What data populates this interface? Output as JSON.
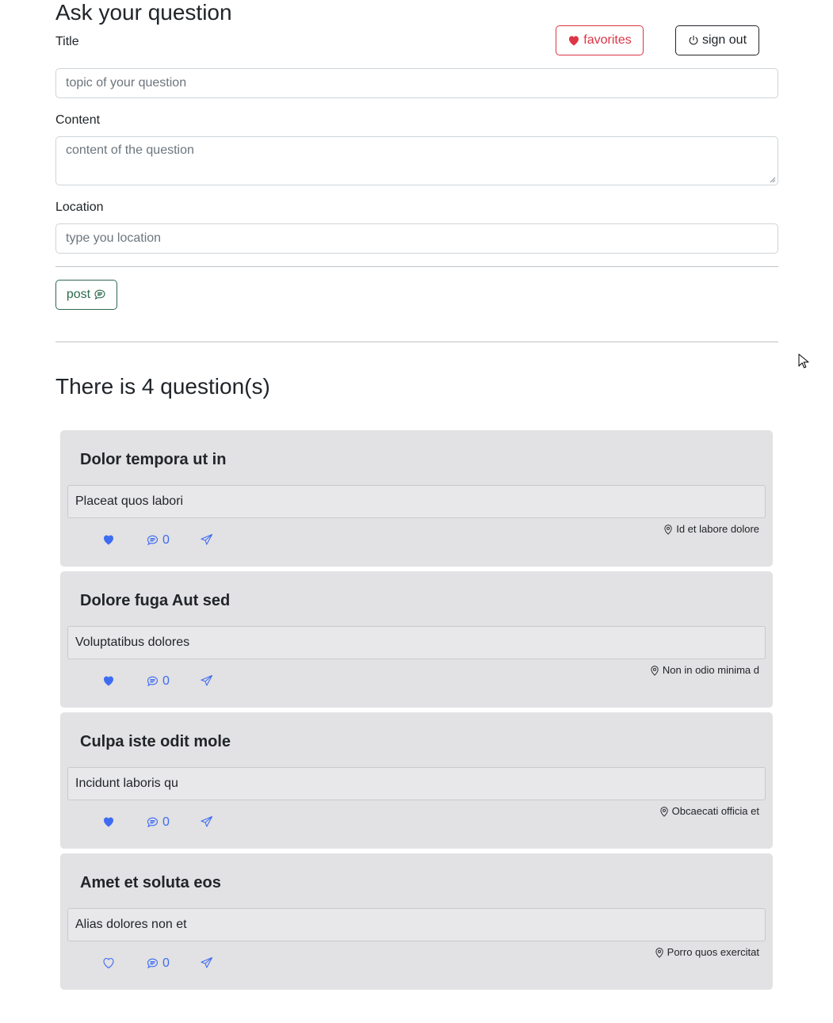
{
  "page": {
    "title": "Ask your question"
  },
  "header": {
    "favorites_label": "favorites",
    "signout_label": "sign out"
  },
  "form": {
    "title_label": "Title",
    "title_placeholder": "topic of your question",
    "content_label": "Content",
    "content_placeholder": "content of the question",
    "location_label": "Location",
    "location_placeholder": "type you location",
    "post_label": "post"
  },
  "list": {
    "count_heading": "There is 4 question(s)",
    "questions": [
      {
        "title": "Dolor tempora ut in",
        "content": "Placeat quos labori",
        "location": "Id et labore dolore",
        "comments": "0",
        "liked": true
      },
      {
        "title": "Dolore fuga Aut sed",
        "content": "Voluptatibus dolores",
        "location": "Non in odio minima d",
        "comments": "0",
        "liked": true
      },
      {
        "title": "Culpa iste odit mole",
        "content": "Incidunt laboris qu",
        "location": "Obcaecati officia et",
        "comments": "0",
        "liked": true
      },
      {
        "title": "Amet et soluta eos",
        "content": "Alias dolores non et",
        "location": "Porro quos exercitat",
        "comments": "0",
        "liked": false
      }
    ]
  },
  "colors": {
    "like": "#3d6cf2",
    "favorites": "#dc3545",
    "post": "#2e6a4f",
    "card_bg": "#e2e1e3"
  },
  "icons": {
    "favorites": "heart-fill-icon",
    "signout": "power-icon",
    "post": "chat-left-text-icon",
    "location": "geo-alt-icon",
    "share": "send-icon"
  }
}
